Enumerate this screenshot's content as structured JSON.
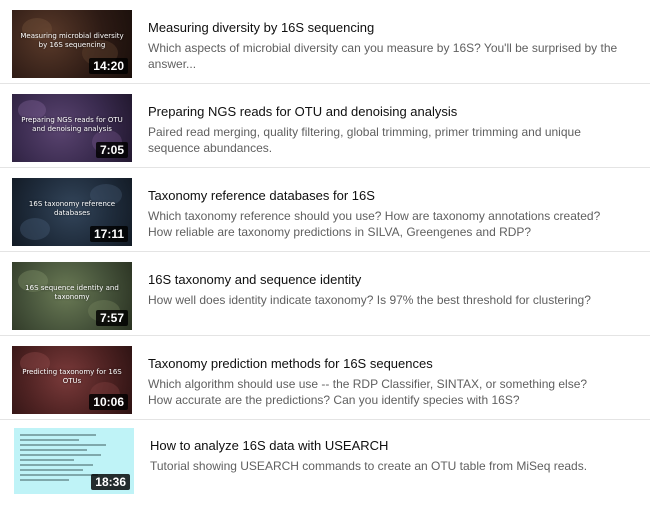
{
  "videos": [
    {
      "thumb_text": "Measuring microbial diversity by 16S sequencing",
      "duration": "14:20",
      "title": "Measuring diversity by 16S sequencing",
      "desc_line1": "Which aspects of microbial diversity can you measure by 16S? You'll be surprised by the",
      "desc_line2": "answer..."
    },
    {
      "thumb_text": "Preparing NGS reads for OTU and denoising analysis",
      "duration": "7:05",
      "title": "Preparing NGS reads for OTU and denoising analysis",
      "desc_line1": "Paired read merging, quality filtering, global trimming, primer trimming and unique",
      "desc_line2": "sequence abundances."
    },
    {
      "thumb_text": "16S taxonomy reference databases",
      "duration": "17:11",
      "title": "Taxonomy reference databases for 16S",
      "desc_line1": "Which taxonomy reference should you use? How are taxonomy annotations created?",
      "desc_line2": "How reliable are taxonomy predictions in SILVA, Greengenes and RDP?"
    },
    {
      "thumb_text": "16S sequence identity and taxonomy",
      "duration": "7:57",
      "title": "16S taxonomy and sequence identity",
      "desc_line1": "How well does identity indicate taxonomy? Is 97% the best threshold for clustering?",
      "desc_line2": ""
    },
    {
      "thumb_text": "Predicting taxonomy for 16S OTUs",
      "duration": "10:06",
      "title": "Taxonomy prediction methods for 16S sequences",
      "desc_line1": "Which algorithm should use use -- the RDP Classifier, SINTAX, or something else?",
      "desc_line2": "How accurate are the predictions? Can you identify species with 16S?"
    },
    {
      "thumb_text": "",
      "duration": "18:36",
      "title": "How to analyze 16S data with USEARCH",
      "desc_line1": "Tutorial showing USEARCH commands to create an OTU table from MiSeq reads.",
      "desc_line2": ""
    }
  ]
}
